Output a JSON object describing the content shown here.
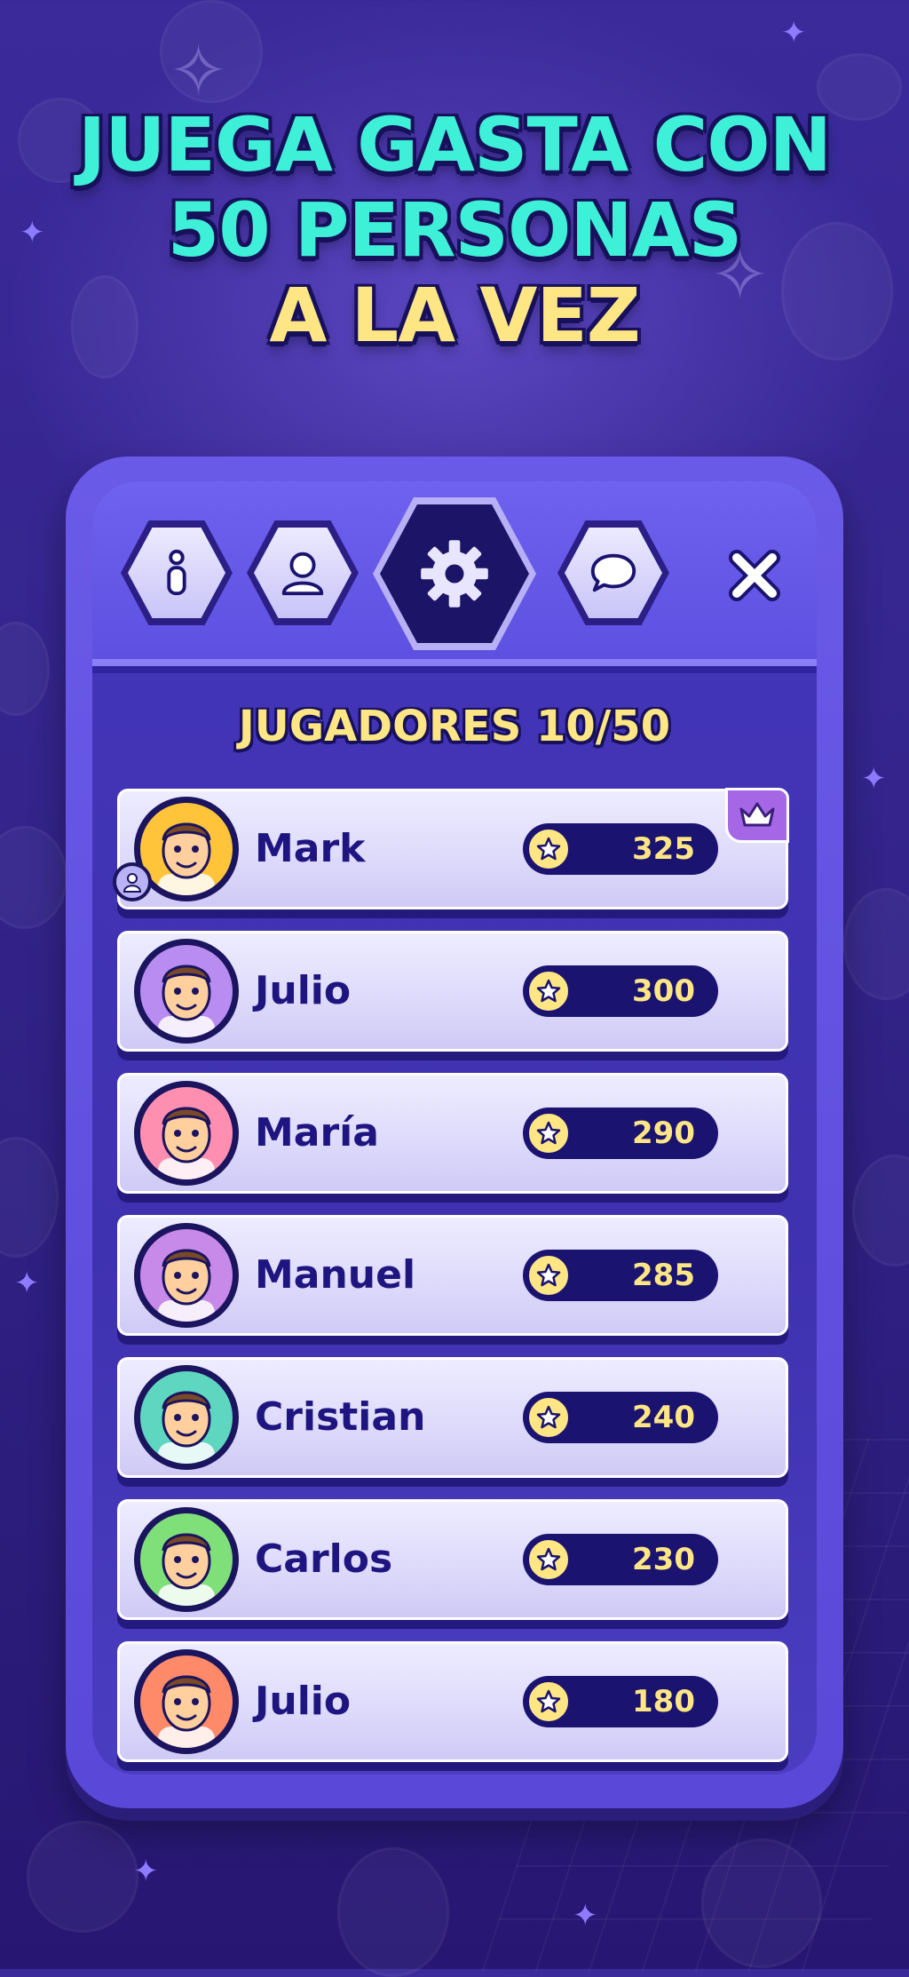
{
  "headline": {
    "line1": "JUEGA GASTA CON",
    "line2": "50 PERSONAS",
    "line3": "A LA VEZ"
  },
  "panel": {
    "tabs": [
      {
        "icon": "info-icon",
        "active": false
      },
      {
        "icon": "user-icon",
        "active": false
      },
      {
        "icon": "gear-icon",
        "active": true
      },
      {
        "icon": "chat-bubble-icon",
        "active": false
      }
    ],
    "close_icon": "close-icon",
    "players_title": "JUGADORES 10/50"
  },
  "players": [
    {
      "name": "Mark",
      "score": "325",
      "host": true,
      "crown": true,
      "avatar_color": "#ffc43a"
    },
    {
      "name": "Julio",
      "score": "300",
      "avatar_color": "#b88cf0"
    },
    {
      "name": "María",
      "score": "290",
      "avatar_color": "#ff8fb0"
    },
    {
      "name": "Manuel",
      "score": "285",
      "avatar_color": "#c78ae8"
    },
    {
      "name": "Cristian",
      "score": "240",
      "avatar_color": "#5fd6c0"
    },
    {
      "name": "Carlos",
      "score": "230",
      "avatar_color": "#7fe07a"
    },
    {
      "name": "Julio",
      "score": "180",
      "avatar_color": "#ff8a6a"
    }
  ],
  "colors": {
    "accent_teal": "#3ff0d8",
    "accent_yellow": "#ffe685",
    "navy": "#1a1370",
    "crown_purple": "#a667e6"
  }
}
